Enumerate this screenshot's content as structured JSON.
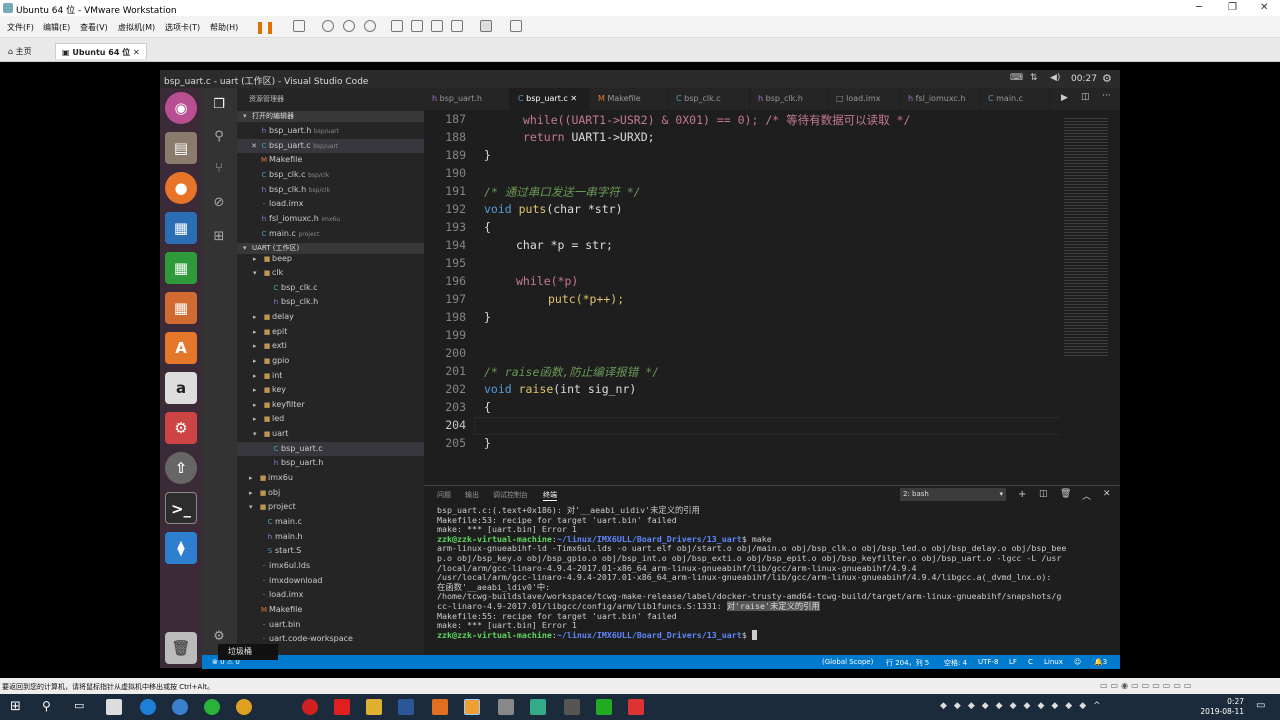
{
  "vmware": {
    "title": "Ubuntu 64 位 - VMware Workstation",
    "menu": [
      "文件(F)",
      "编辑(E)",
      "查看(V)",
      "虚拟机(M)",
      "选项卡(T)",
      "帮助(H)"
    ],
    "tabs": [
      "主页",
      "Ubuntu 64 位"
    ],
    "hint": "要返回到您的计算机，请将鼠标指针从虚拟机中移出或按 Ctrl+Alt。"
  },
  "ubuntu": {
    "clock": "00:27",
    "tooltip": "垃圾桶"
  },
  "vscode": {
    "title": "bsp_uart.c - uart (工作区) - Visual Studio Code",
    "sidebar": {
      "header": "资源管理器",
      "open_editors_title": "打开的编辑器",
      "open_editors": [
        {
          "name": "bsp_uart.h",
          "path": "bsp/uart"
        },
        {
          "name": "bsp_uart.c",
          "path": "bsp/uart"
        },
        {
          "name": "Makefile",
          "path": ""
        },
        {
          "name": "bsp_clk.c",
          "path": "bsp/clk"
        },
        {
          "name": "bsp_clk.h",
          "path": "bsp/clk"
        },
        {
          "name": "load.imx",
          "path": ""
        },
        {
          "name": "fsl_iomuxc.h",
          "path": "imx6u"
        },
        {
          "name": "main.c",
          "path": "project"
        }
      ],
      "workspace_title": "UART (工作区)",
      "tree": [
        "beep",
        "clk",
        "bsp_clk.c",
        "bsp_clk.h",
        "delay",
        "epit",
        "exti",
        "gpio",
        "int",
        "key",
        "keyfilter",
        "led",
        "uart",
        "bsp_uart.c",
        "bsp_uart.h",
        "imx6u",
        "obj",
        "project",
        "main.c",
        "main.h",
        "start.S",
        "imx6ul.lds",
        "imxdownload",
        "load.imx",
        "Makefile",
        "uart.bin",
        "uart.code-workspace"
      ]
    },
    "tabs": [
      "bsp_uart.h",
      "bsp_uart.c",
      "Makefile",
      "bsp_clk.c",
      "bsp_clk.h",
      "load.imx",
      "fsl_iomuxc.h",
      "main.c"
    ],
    "line_numbers": [
      "187",
      "188",
      "189",
      "190",
      "191",
      "192",
      "193",
      "194",
      "195",
      "196",
      "197",
      "198",
      "199",
      "200",
      "201",
      "202",
      "203",
      "204",
      "205"
    ],
    "code": {
      "l187": "while((UART1->USR2) & 0X01) == 0); /* 等待有数据可以读取 */",
      "l188_a": "return ",
      "l188_b": "UART1->URXD;",
      "l189": "}",
      "l191": "/* 通过串口发送一串字符 */",
      "l192_a": "void ",
      "l192_b": "puts",
      "l192_c": "(char *str)",
      "l193": "{",
      "l194": "char *p = str;",
      "l196": "while(*p)",
      "l197": "putc(*p++);",
      "l198": "}",
      "l201": "/* raise函数,防止编译报错 */",
      "l202_a": "void ",
      "l202_b": "raise",
      "l202_c": "(int sig_nr)",
      "l203": "{",
      "l205": "}"
    },
    "panel": {
      "tabs": [
        "问题",
        "输出",
        "调试控制台",
        "终端"
      ],
      "terminal_select": "2: bash",
      "lines": [
        "bsp_uart.c:(.text+0x186): 对'__aeabi_uidiv'未定义的引用",
        "Makefile:53: recipe for target 'uart.bin' failed",
        "make: *** [uart.bin] Error 1",
        "arm-linux-gnueabihf-ld -Timx6ul.lds -o uart.elf obj/start.o obj/main.o obj/bsp_clk.o obj/bsp_led.o obj/bsp_delay.o obj/bsp_bee",
        "p.o obj/bsp_key.o obj/bsp_gpio.o obj/bsp_int.o obj/bsp_exti.o obj/bsp_epit.o obj/bsp_keyfilter.o obj/bsp_uart.o -lgcc -L /usr",
        "/local/arm/gcc-linaro-4.9.4-2017.01-x86_64_arm-linux-gnueabihf/lib/gcc/arm-linux-gnueabihf/4.9.4",
        "/usr/local/arm/gcc-linaro-4.9.4-2017.01-x86_64_arm-linux-gnueabihf/lib/gcc/arm-linux-gnueabihf/4.9.4/libgcc.a(_dvmd_lnx.o):",
        "在函数'__aeabi_ldiv0'中:",
        "/home/tcwg-buildslave/workspace/tcwg-make-release/label/docker-trusty-amd64-tcwg-build/target/arm-linux-gnueabihf/snapshots/g",
        "cc-linaro-4.9-2017.01/libgcc/config/arm/lib1funcs.S:1331: ",
        "Makefile:55: recipe for target 'uart.bin' failed",
        "make: *** [uart.bin] Error 1"
      ],
      "undef_ref": "对'raise'未定义的引用",
      "prompt_user": "zzk@zzk-virtual-machine",
      "prompt_path": "~/linux/IMX6ULL/Board_Drivers/13_uart",
      "cmd_make": "make"
    },
    "statusbar": {
      "errors": "0",
      "warnings": "0",
      "scope": "(Global Scope)",
      "position": "行 204，列 5",
      "spaces": "空格: 4",
      "encoding": "UTF-8",
      "eol": "LF",
      "language": "C",
      "os": "Linux",
      "notifications": "3"
    }
  },
  "taskbar": {
    "time": "0:27",
    "date": "2019-08-11"
  }
}
